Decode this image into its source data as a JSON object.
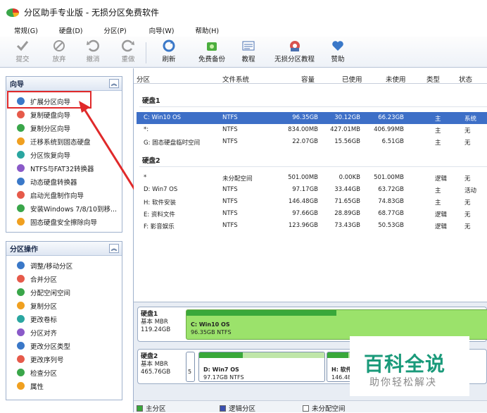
{
  "window": {
    "title": "分区助手专业版 - 无损分区免费软件"
  },
  "menu": [
    "常规(G)",
    "硬盘(D)",
    "分区(P)",
    "向导(W)",
    "帮助(H)"
  ],
  "toolbar": [
    {
      "label": "提交",
      "icon": "check-icon",
      "enabled": false
    },
    {
      "label": "放弃",
      "icon": "discard-icon",
      "enabled": false
    },
    {
      "label": "撤消",
      "icon": "undo-icon",
      "enabled": false
    },
    {
      "label": "重做",
      "icon": "redo-icon",
      "enabled": false
    },
    {
      "label": "刷新",
      "icon": "refresh-icon",
      "enabled": true
    },
    {
      "label": "免费备份",
      "icon": "backup-icon",
      "enabled": true
    },
    {
      "label": "教程",
      "icon": "tutorial-icon",
      "enabled": true
    },
    {
      "label": "无损分区教程",
      "icon": "partition-tutorial-icon",
      "enabled": true
    },
    {
      "label": "赞助",
      "icon": "heart-icon",
      "enabled": true
    }
  ],
  "wizard": {
    "title": "向导",
    "items": [
      "扩展分区向导",
      "复制硬盘向导",
      "复制分区向导",
      "迁移系统到固态硬盘",
      "分区恢复向导",
      "NTFS与FAT32转换器",
      "动态硬盘转换器",
      "启动光盘制作向导",
      "安装Windows 7/8/10到移...",
      "固态硬盘安全擦除向导"
    ]
  },
  "ops": {
    "title": "分区操作",
    "items": [
      "调整/移动分区",
      "合并分区",
      "分配空闲空间",
      "复制分区",
      "更改卷标",
      "分区对齐",
      "更改分区类型",
      "更改序列号",
      "检查分区",
      "属性"
    ]
  },
  "table": {
    "columns": [
      "分区",
      "文件系统",
      "容量",
      "已使用",
      "未使用",
      "类型",
      "状态"
    ],
    "disks": [
      {
        "name": "硬盘1",
        "rows": [
          [
            "C: Win10 OS",
            "NTFS",
            "96.35GB",
            "30.12GB",
            "66.23GB",
            "主",
            "系统"
          ],
          [
            "*:",
            "NTFS",
            "834.00MB",
            "427.01MB",
            "406.99MB",
            "主",
            "无"
          ],
          [
            "G: 固态硬盘临时空间",
            "NTFS",
            "22.07GB",
            "15.56GB",
            "6.51GB",
            "主",
            "无"
          ]
        ]
      },
      {
        "name": "硬盘2",
        "rows": [
          [
            "*",
            "未分配空间",
            "501.00MB",
            "0.00KB",
            "501.00MB",
            "逻辑",
            "无"
          ],
          [
            "D: Win7 OS",
            "NTFS",
            "97.17GB",
            "33.44GB",
            "63.72GB",
            "主",
            "活动"
          ],
          [
            "H: 软件安装",
            "NTFS",
            "146.48GB",
            "71.65GB",
            "74.83GB",
            "主",
            "无"
          ],
          [
            "E: 资料文件",
            "NTFS",
            "97.66GB",
            "28.89GB",
            "68.77GB",
            "逻辑",
            "无"
          ],
          [
            "F: 影音娱乐",
            "NTFS",
            "123.96GB",
            "73.43GB",
            "50.53GB",
            "逻辑",
            "无"
          ]
        ]
      }
    ]
  },
  "diskmap": [
    {
      "name": "硬盘1",
      "type": "基本 MBR",
      "size": "119.24GB",
      "parts": [
        {
          "label": "C: Win10 OS",
          "info": "96.35GB NTFS"
        }
      ]
    },
    {
      "name": "硬盘2",
      "type": "基本 MBR",
      "size": "465.76GB",
      "parts": [
        {
          "label": "",
          "info": "5"
        },
        {
          "label": "D: Win7 OS",
          "info": "97.17GB NTFS"
        },
        {
          "label": "H: 软件",
          "info": "146.48"
        }
      ]
    }
  ],
  "legend": [
    "主分区",
    "逻辑分区",
    "未分配空间"
  ],
  "watermark": {
    "title": "百科全说",
    "sub": "助你轻松解决"
  }
}
